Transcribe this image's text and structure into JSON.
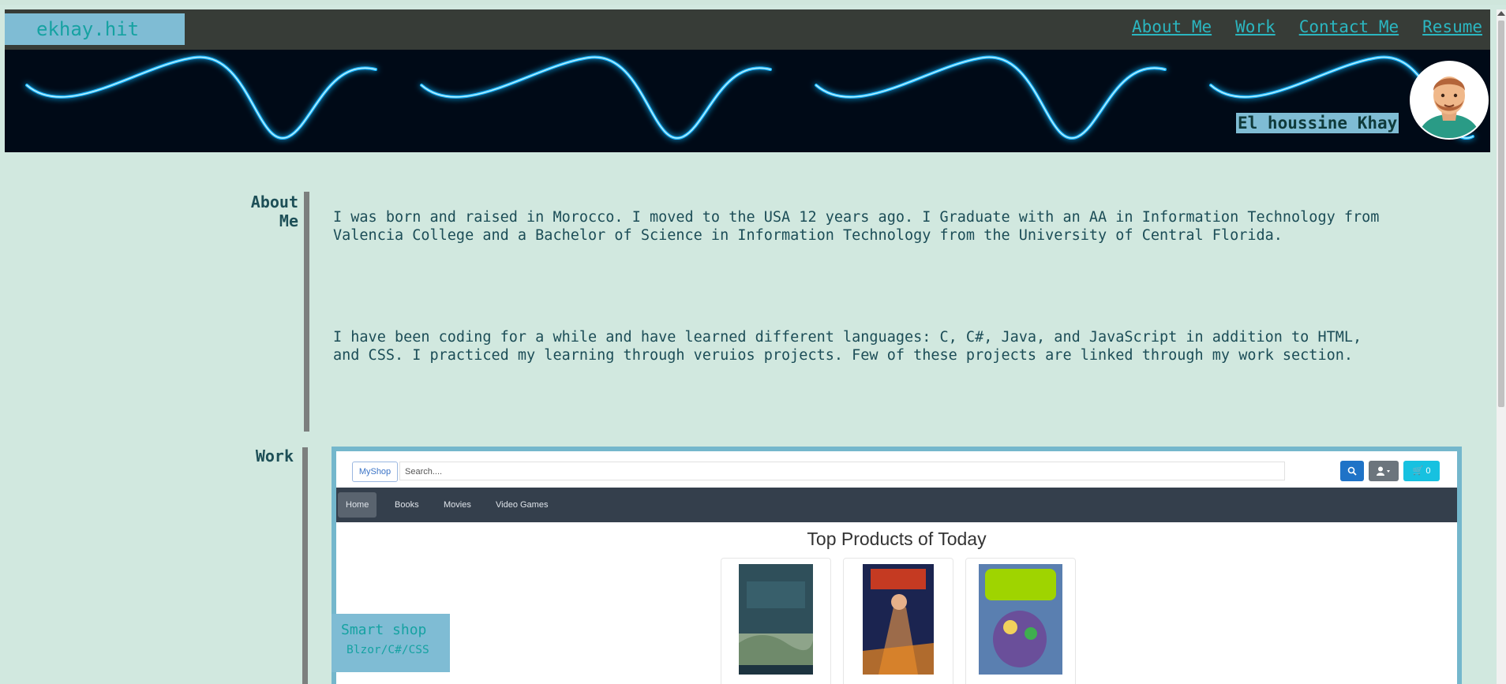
{
  "site": {
    "brand": "ekhay.hit",
    "owner_name": "El houssine Khay"
  },
  "nav": {
    "items": [
      "About Me",
      "Work",
      "Contact Me",
      "Resume"
    ]
  },
  "about": {
    "label": "About\nMe",
    "paragraphs": [
      "I was born and raised in Morocco. I moved to the USA 12 years ago. I Graduate with an AA in Information Technology from Valencia College and a Bachelor of Science in Information Technology from the University of Central Florida.",
      "I have been coding for a while and have learned different languages: C, C#, Java, and JavaScript in addition to HTML, and CSS. I practiced my learning through veruios projects. Few of these projects are linked through my work section."
    ]
  },
  "work": {
    "label": "Work",
    "project": {
      "name": "Smart shop",
      "tech": "Blzor/C#/CSS"
    },
    "screenshot": {
      "brand": "MyShop",
      "search_placeholder": "Search....",
      "cart_count": "0",
      "tabs": [
        "Home",
        "Books",
        "Movies",
        "Video Games"
      ],
      "heading": "Top Products of Today"
    }
  },
  "colors": {
    "page_bg": "#d1e8df",
    "navbar": "#373c37",
    "accent_box": "#7fbcd4",
    "link": "#2bb6c0",
    "banner_wave": "#18b6ff"
  },
  "icons": [
    "search-icon",
    "user-icon",
    "cart-icon",
    "avatar-icon"
  ]
}
